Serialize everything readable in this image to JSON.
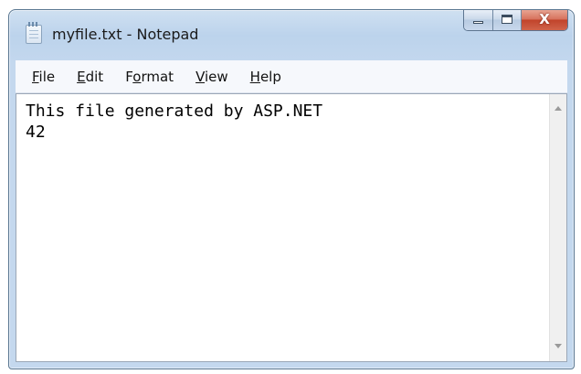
{
  "window": {
    "title": "myfile.txt - Notepad",
    "icon": "notepad-icon"
  },
  "controls": {
    "minimize_icon": "minimize-icon",
    "maximize_icon": "maximize-icon",
    "close_icon": "close-icon",
    "close_glyph": "X"
  },
  "menu": {
    "items": [
      {
        "key": "F",
        "rest": "ile"
      },
      {
        "key": "E",
        "rest": "dit"
      },
      {
        "key": "F",
        "pre": "F",
        "rest": "ormat"
      },
      {
        "key": "V",
        "rest": "iew"
      },
      {
        "key": "H",
        "rest": "elp"
      }
    ]
  },
  "editor": {
    "lines": [
      "This file generated by ASP.NET",
      "42"
    ]
  },
  "colors": {
    "close_button": "#c1442b",
    "titlebar": "#bcd3ec"
  }
}
